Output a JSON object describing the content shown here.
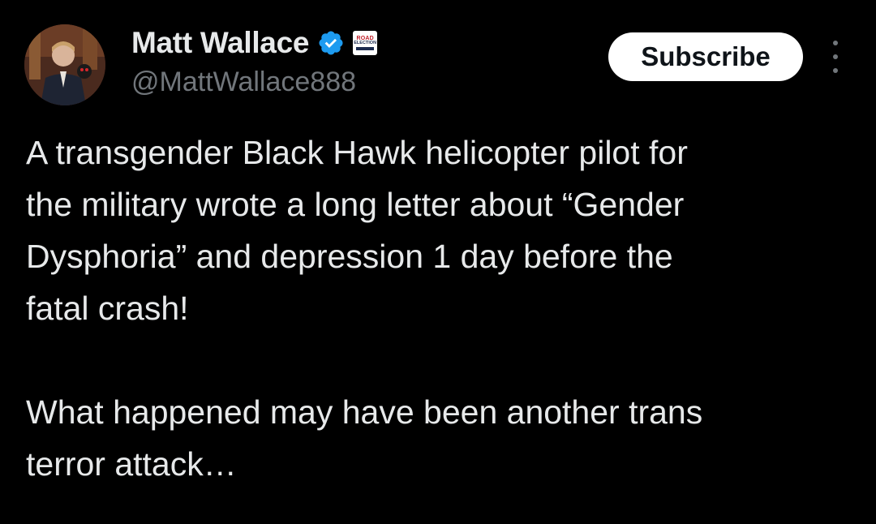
{
  "author": {
    "display_name": "Matt Wallace",
    "handle": "@MattWallace888",
    "verified_icon": "verified-check-icon",
    "verified_color": "#1d9bf0",
    "affiliation_badge": {
      "line1": "ROAD",
      "line2": "ELECTION"
    }
  },
  "actions": {
    "subscribe_label": "Subscribe",
    "more_icon": "more-options-icon"
  },
  "post": {
    "paragraphs": [
      "A transgender Black Hawk helicopter pilot for\nthe military wrote a long letter about “Gender\nDysphoria” and depression 1 day before the\nfatal crash!",
      "What happened may have been another trans\nterror attack…"
    ]
  },
  "colors": {
    "background": "#000000",
    "text_primary": "#e7e9ea",
    "text_secondary": "#71767b",
    "button_bg": "#ffffff",
    "button_text": "#0f1419"
  }
}
